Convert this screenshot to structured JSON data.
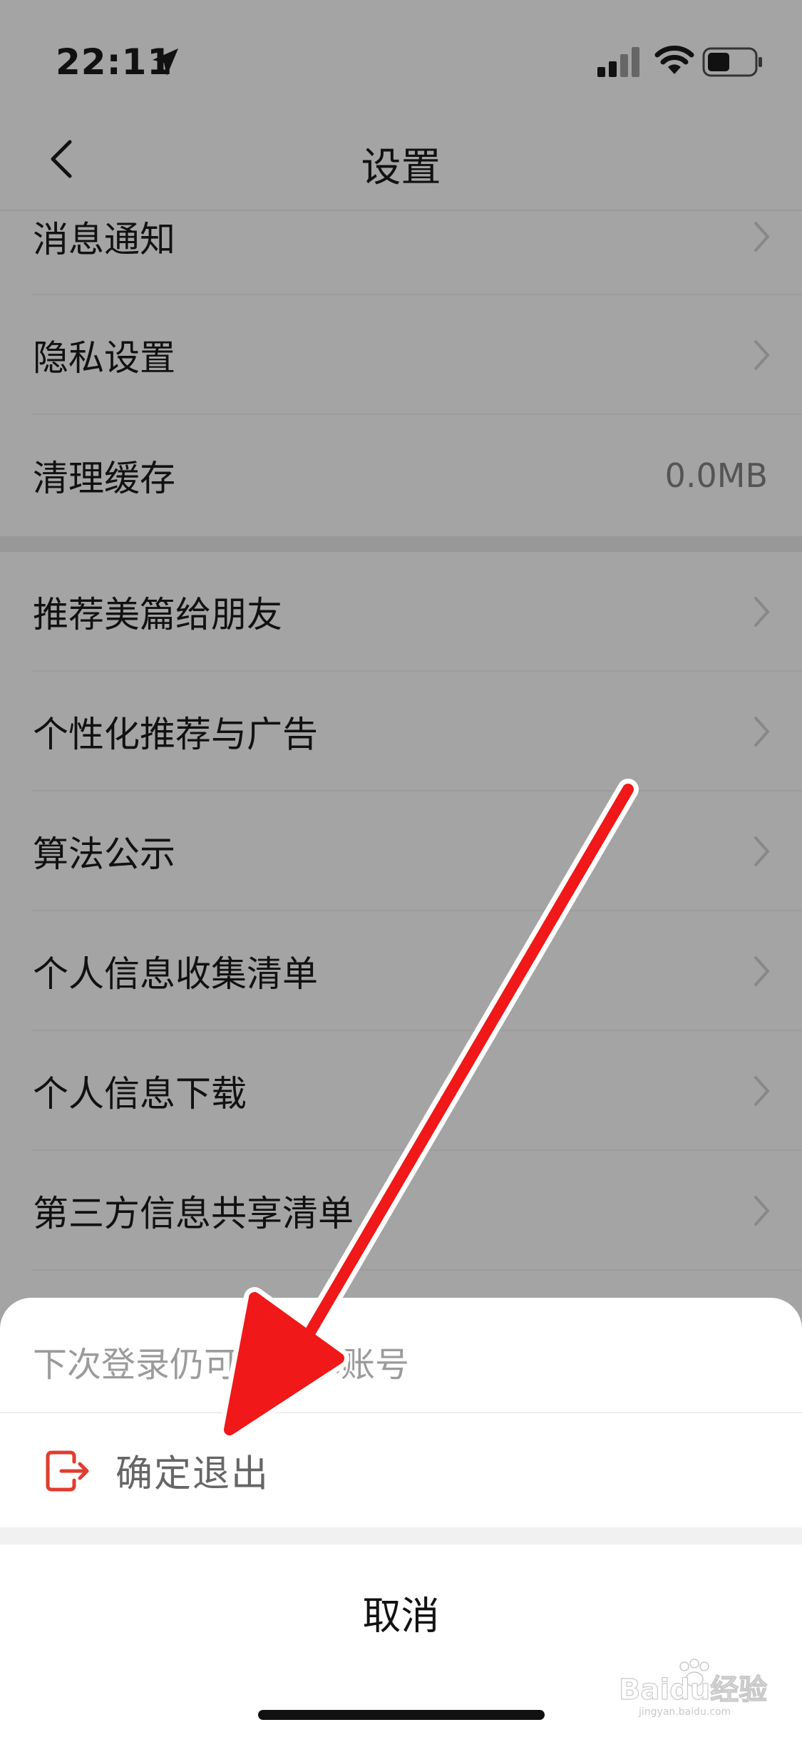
{
  "status_bar": {
    "time": "22:11"
  },
  "header": {
    "title": "设置"
  },
  "settings": {
    "items": [
      {
        "label": "消息通知"
      },
      {
        "label": "隐私设置"
      },
      {
        "label": "清理缓存",
        "value": "0.0MB"
      },
      {
        "label": "推荐美篇给朋友"
      },
      {
        "label": "个性化推荐与广告"
      },
      {
        "label": "算法公示"
      },
      {
        "label": "个人信息收集清单"
      },
      {
        "label": "个人信息下载"
      },
      {
        "label": "第三方信息共享清单"
      }
    ]
  },
  "sheet": {
    "hint": "下次登录仍可使用本账号",
    "confirm_label": "确定退出",
    "cancel_label": "取消"
  },
  "watermark": {
    "brand": "Baidu经验",
    "url": "jingyan.baidu.com"
  },
  "colors": {
    "accent_red": "#e23b2e",
    "arrow_red": "#f01818",
    "overlay_gray": "#a4a4a4"
  }
}
